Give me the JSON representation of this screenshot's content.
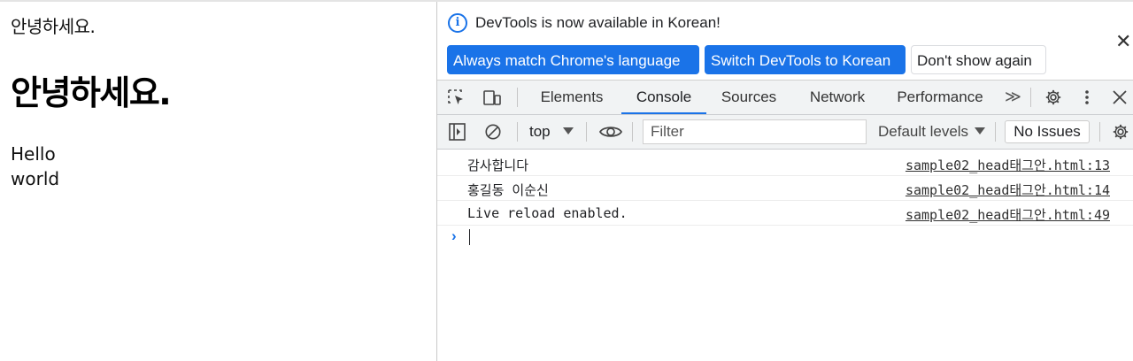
{
  "page": {
    "greeting_small": "안녕하세요.",
    "greeting_heading": "안녕하세요.",
    "line1": "Hello",
    "line2": "world"
  },
  "infobar": {
    "message": "DevTools is now available in Korean!",
    "buttons": [
      "Always match Chrome's language",
      "Switch DevTools to Korean",
      "Don't show again"
    ],
    "close_glyph": "✕"
  },
  "tabs": {
    "items": [
      "Elements",
      "Console",
      "Sources",
      "Network",
      "Performance"
    ],
    "active": "Console",
    "more_glyph": "≫"
  },
  "toolbar": {
    "context": "top",
    "filter_placeholder": "Filter",
    "levels": "Default levels",
    "issues": "No Issues"
  },
  "console": {
    "logs": [
      {
        "message": "감사합니다",
        "source": "sample02_head태그안.html:13"
      },
      {
        "message": "홍길동 이순신",
        "source": "sample02_head태그안.html:14"
      },
      {
        "message": "Live reload enabled.",
        "source": "sample02_head태그안.html:49"
      }
    ],
    "prompt_glyph": "›"
  },
  "colors": {
    "accent": "#1a73e8",
    "toolbar_bg": "#f1f3f4"
  },
  "icons": [
    "info-icon",
    "inspect-icon",
    "device-toggle-icon",
    "gear-icon",
    "kebab-menu-icon",
    "close-icon",
    "sidebar-toggle-icon",
    "clear-console-icon",
    "eye-icon"
  ]
}
